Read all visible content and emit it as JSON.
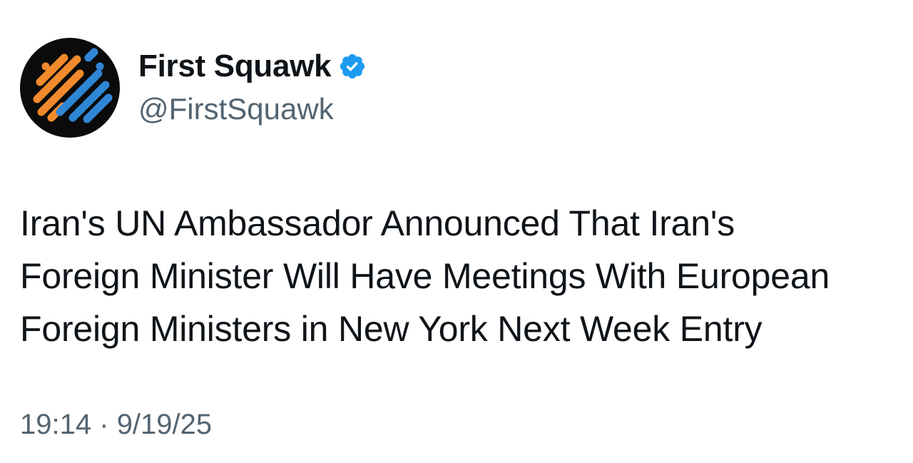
{
  "author": {
    "display_name": "First Squawk",
    "handle": "@FirstSquawk",
    "verified": true,
    "verified_icon": "verified-badge-icon",
    "avatar_icon": "first-squawk-logo-icon"
  },
  "tweet": {
    "lines": [
      "Iran's UN Ambassador Announced That Iran's",
      "Foreign Minister Will Have Meetings With European",
      "Foreign Ministers in New York Next Week Entry"
    ]
  },
  "meta": {
    "time": "19:14",
    "separator": "·",
    "date": "9/19/25"
  },
  "colors": {
    "text": "#0f1419",
    "secondary": "#536471",
    "verified_blue": "#1d9bf0",
    "logo_orange": "#f08a2c",
    "logo_blue": "#2f86d6",
    "logo_bg": "#0b0b0b"
  }
}
